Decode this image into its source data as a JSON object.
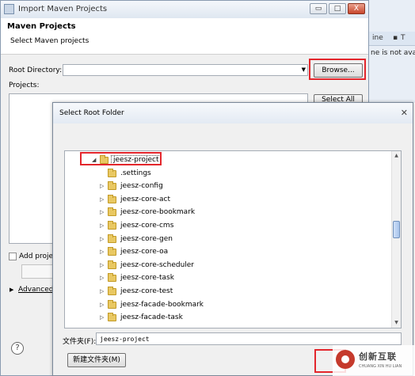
{
  "background_window": {
    "tab_fragment_1": "ine",
    "tab_fragment_2": "T",
    "text_fragment": "ne is not avai"
  },
  "import_dialog": {
    "title": "Import Maven Projects",
    "window_controls": {
      "minimize": "▭",
      "maximize": "□",
      "close": "X"
    },
    "header_title": "Maven Projects",
    "header_subtitle": "Select Maven projects",
    "root_directory_label": "Root Directory:",
    "root_directory_value": "",
    "browse_button": "Browse...",
    "projects_label": "Projects:",
    "select_all_button": "Select All",
    "add_project_label": "Add proje",
    "advanced_label": "Advanced",
    "help_icon": "?"
  },
  "folder_dialog": {
    "title": "Select Root Folder",
    "close_icon": "✕",
    "tree_items": [
      {
        "label": "jeesz-project",
        "expanded": true,
        "selected": true
      },
      {
        "label": ".settings",
        "expanded": false
      },
      {
        "label": "jeesz-config",
        "expanded": false
      },
      {
        "label": "jeesz-core-act",
        "expanded": false
      },
      {
        "label": "jeesz-core-bookmark",
        "expanded": false
      },
      {
        "label": "jeesz-core-cms",
        "expanded": false
      },
      {
        "label": "jeesz-core-gen",
        "expanded": false
      },
      {
        "label": "jeesz-core-oa",
        "expanded": false
      },
      {
        "label": "jeesz-core-scheduler",
        "expanded": false
      },
      {
        "label": "jeesz-core-task",
        "expanded": false
      },
      {
        "label": "jeesz-core-test",
        "expanded": false
      },
      {
        "label": "jeesz-facade-bookmark",
        "expanded": false
      },
      {
        "label": "jeesz-facade-task",
        "expanded": false
      }
    ],
    "folder_label": "文件夹(F):",
    "folder_value": "jeesz-project",
    "new_folder_button": "新建文件夹(M)"
  },
  "watermark": {
    "text_cn": "创新互联",
    "text_en": "CHUANG XIN HU LIAN"
  },
  "colors": {
    "highlight": "#e3262c",
    "folder": "#e9c862"
  }
}
